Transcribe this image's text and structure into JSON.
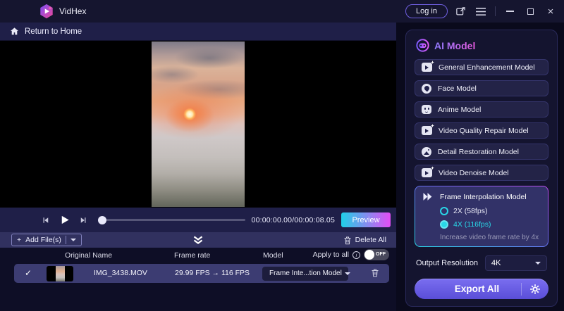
{
  "titlebar": {
    "app_name": "VidHex",
    "login_label": "Log in"
  },
  "nav": {
    "return_home": "Return to Home"
  },
  "player": {
    "time_display": "00:00:00.00/00:00:08.05",
    "preview_label": "Preview"
  },
  "toolbar": {
    "add_files_label": "Add File(s)",
    "add_files_plus": "+",
    "delete_all_label": "Delete All"
  },
  "table": {
    "headers": [
      "Original Name",
      "Frame rate",
      "Model",
      "Apply to all"
    ],
    "apply_toggle_state": "OFF",
    "rows": [
      {
        "checked": "✓",
        "name": "IMG_3438.MOV",
        "frame_rate": "29.99 FPS → 116 FPS",
        "model": "Frame Inte...tion Model"
      }
    ]
  },
  "ai_panel": {
    "title": "AI Model",
    "models": [
      "General Enhancement Model",
      "Face Model",
      "Anime Model",
      "Video Quality Repair Model",
      "Detail Restoration Model",
      "Video Denoise Model"
    ],
    "selected_model": {
      "name": "Frame Interpolation Model",
      "options": [
        {
          "label": "2X (58fps)",
          "selected": false
        },
        {
          "label": "4X (116fps)",
          "selected": true
        }
      ],
      "description": "Increase video frame rate by 4x"
    },
    "output_resolution_label": "Output Resolution",
    "output_resolution_value": "4K",
    "export_label": "Export All"
  },
  "icons": {
    "logo": "hexagon-play-icon",
    "home": "home-icon",
    "feedback": "feedback-edit-icon",
    "menu": "hamburger-menu-icon",
    "window": [
      "minimize-icon",
      "maximize-icon",
      "close-icon"
    ],
    "player": [
      "previous-frame-icon",
      "play-icon",
      "next-frame-icon"
    ],
    "collapse": "double-chevron-down-icon",
    "trash": "trash-icon",
    "robot": "ai-robot-icon",
    "gear": "gear-icon",
    "fast_forward": "frame-interpolation-icon"
  },
  "colors": {
    "accent_cyan": "#29d8e8",
    "accent_magenta": "#e44df5",
    "accent_purple": "#6c5ce7",
    "row_highlight": "#3c3c72",
    "panel_bg": "#14142f",
    "titlebar_bg": "#15152f"
  }
}
